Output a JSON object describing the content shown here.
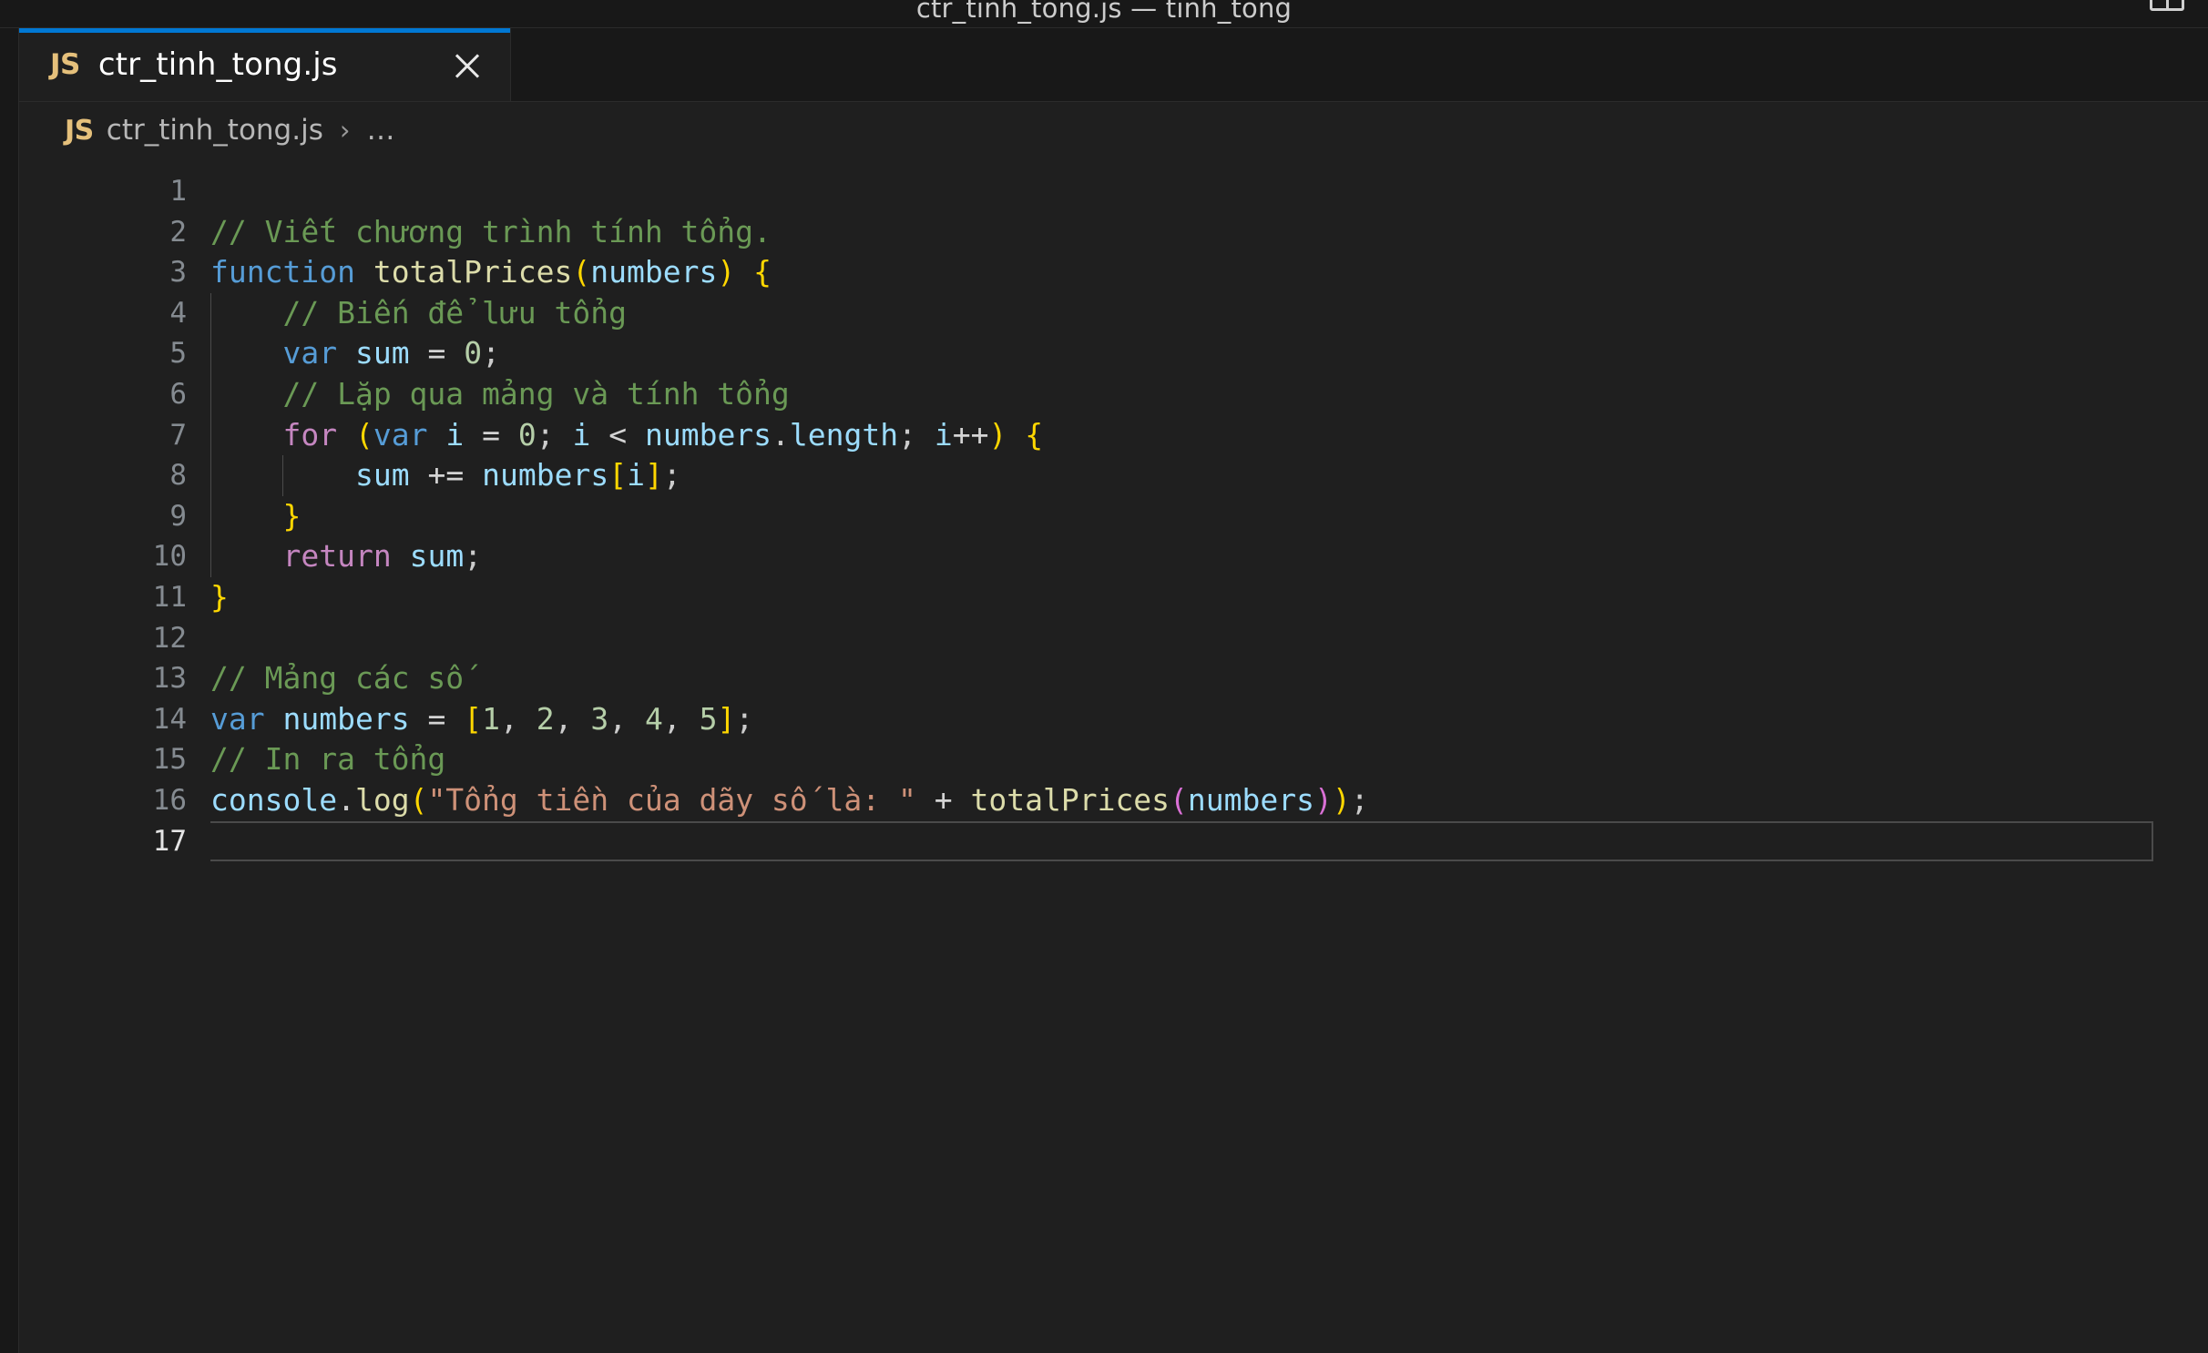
{
  "window": {
    "title": "ctr_tinh_tong.js — tinh_tong",
    "split_editor_icon": "split-editor-icon"
  },
  "tabs": [
    {
      "icon": "JS",
      "icon_name": "js-file-icon",
      "label": "ctr_tinh_tong.js",
      "close_icon": "close-icon",
      "active": true
    }
  ],
  "breadcrumbs": {
    "icon": "JS",
    "file": "ctr_tinh_tong.js",
    "separator": "›",
    "more": "…"
  },
  "editor": {
    "language": "javascript",
    "total_lines": 17,
    "current_line": 17,
    "line_numbers": [
      "1",
      "2",
      "3",
      "4",
      "5",
      "6",
      "7",
      "8",
      "9",
      "10",
      "11",
      "12",
      "13",
      "14",
      "15",
      "16",
      "17"
    ],
    "lines": [
      {
        "n": 1,
        "text": ""
      },
      {
        "n": 2,
        "text": "// Viết chương trình tính tổng."
      },
      {
        "n": 3,
        "text": "function totalPrices(numbers) {"
      },
      {
        "n": 4,
        "text": "    // Biến để lưu tổng"
      },
      {
        "n": 5,
        "text": "    var sum = 0;"
      },
      {
        "n": 6,
        "text": "    // Lặp qua mảng và tính tổng"
      },
      {
        "n": 7,
        "text": "    for (var i = 0; i < numbers.length; i++) {"
      },
      {
        "n": 8,
        "text": "        sum += numbers[i];"
      },
      {
        "n": 9,
        "text": "    }"
      },
      {
        "n": 10,
        "text": "    return sum;"
      },
      {
        "n": 11,
        "text": "}"
      },
      {
        "n": 12,
        "text": ""
      },
      {
        "n": 13,
        "text": "// Mảng các số"
      },
      {
        "n": 14,
        "text": "var numbers = [1, 2, 3, 4, 5];"
      },
      {
        "n": 15,
        "text": "// In ra tổng"
      },
      {
        "n": 16,
        "text": "console.log(\"Tổng tiền của dãy số là: \" + totalPrices(numbers));"
      },
      {
        "n": 17,
        "text": ""
      }
    ]
  },
  "colors": {
    "editor_background": "#1f1f1f",
    "chrome_background": "#181818",
    "active_tab_border": "#0078d4",
    "line_number": "#858b91",
    "active_line_number": "#e4e4e4",
    "comment": "#6A9955",
    "keyword": "#569CD6",
    "control": "#C586C0",
    "function": "#DCDCAA",
    "variable": "#9CDCFE",
    "number": "#B5CEA8",
    "string": "#CE9178",
    "bracket_level_0": "#FFD700",
    "bracket_level_1": "#DA70D6",
    "bracket_level_2": "#179FFF",
    "js_icon": "#e5c07b"
  }
}
